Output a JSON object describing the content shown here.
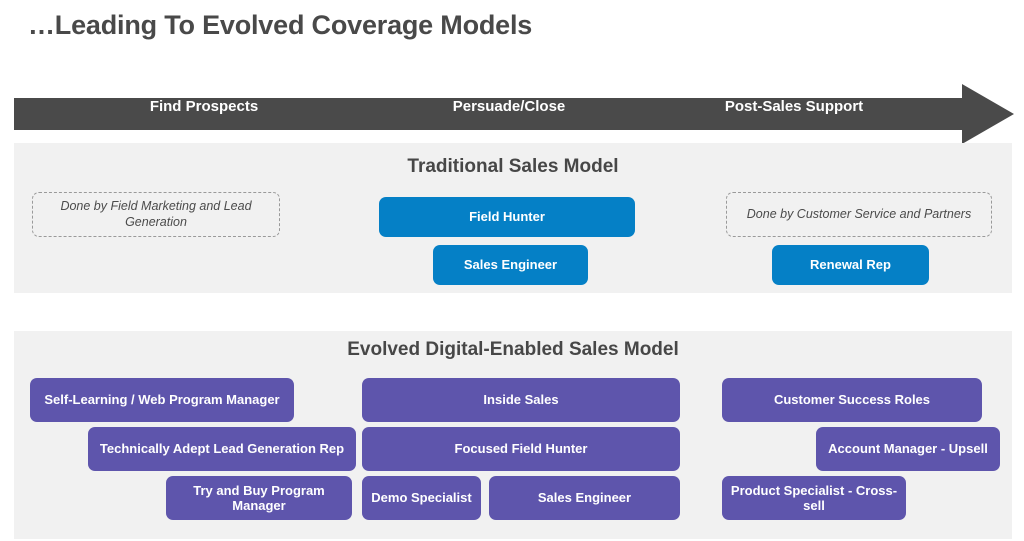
{
  "page": {
    "title": "…Leading To Evolved Coverage Models"
  },
  "colors": {
    "arrow_dark": "#4a4a4a",
    "panel_background": "#f1f1f1",
    "traditional_box": "#0580c6",
    "evolved_box": "#5e55ac",
    "note_border": "#9a9a9a",
    "title_text": "#494949"
  },
  "stage_arrow": {
    "name": "sales-stage-arrow",
    "stages": [
      {
        "label": "Find Prospects"
      },
      {
        "label": "Persuade/Close"
      },
      {
        "label": "Post-Sales Support"
      }
    ]
  },
  "traditional_model": {
    "heading": "Traditional Sales Model",
    "find_prospects": {
      "note": "Done by Field Marketing and Lead Generation"
    },
    "persuade_close": {
      "roles": [
        {
          "label": "Field Hunter"
        },
        {
          "label": "Sales Engineer"
        }
      ]
    },
    "post_sales": {
      "note": "Done by Customer Service and Partners",
      "roles": [
        {
          "label": "Renewal Rep"
        }
      ]
    }
  },
  "evolved_model": {
    "heading": "Evolved Digital-Enabled Sales Model",
    "find_prospects": {
      "roles": [
        {
          "label": "Self-Learning / Web Program Manager"
        },
        {
          "label": "Technically Adept Lead Generation Rep"
        },
        {
          "label": "Try and Buy Program Manager"
        }
      ]
    },
    "persuade_close": {
      "roles": [
        {
          "label": "Inside Sales"
        },
        {
          "label": "Focused Field Hunter"
        },
        {
          "label": "Demo Specialist"
        },
        {
          "label": "Sales Engineer"
        }
      ]
    },
    "post_sales": {
      "roles": [
        {
          "label": "Customer Success Roles"
        },
        {
          "label": "Account Manager - Upsell"
        },
        {
          "label": "Product Specialist - Cross-sell"
        }
      ]
    }
  }
}
